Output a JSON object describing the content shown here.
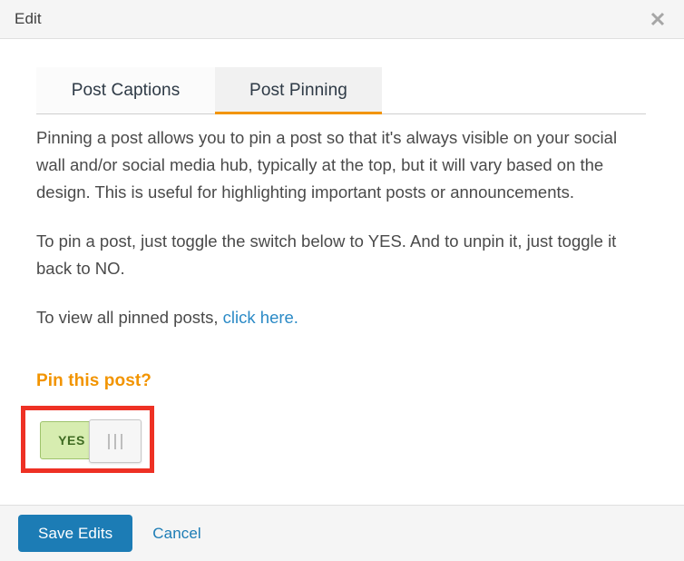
{
  "header": {
    "title": "Edit",
    "close_icon": "close-icon"
  },
  "tabs": [
    {
      "label": "Post Captions",
      "active": false
    },
    {
      "label": "Post Pinning",
      "active": true
    }
  ],
  "body": {
    "paragraph_1": "Pinning a post allows you to pin a post so that it's always visible on your social wall and/or social media hub, typically at the top, but it will vary based on the design. This is useful for highlighting important posts or announcements.",
    "paragraph_2": "To pin a post, just toggle the switch below to YES. And to unpin it, just toggle it back to NO.",
    "paragraph_3_prefix": "To view all pinned posts, ",
    "paragraph_3_link": "click here."
  },
  "pin_section": {
    "heading": "Pin this post?",
    "toggle_value": "YES",
    "toggle_handle_icon": "grip-lines-icon"
  },
  "footer": {
    "save_label": "Save Edits",
    "cancel_label": "Cancel"
  },
  "colors": {
    "accent_orange": "#f29400",
    "link_blue": "#2b8ac6",
    "button_blue": "#1c7cb5",
    "highlight_red": "#ee3124",
    "toggle_green": "#d7edb0"
  }
}
